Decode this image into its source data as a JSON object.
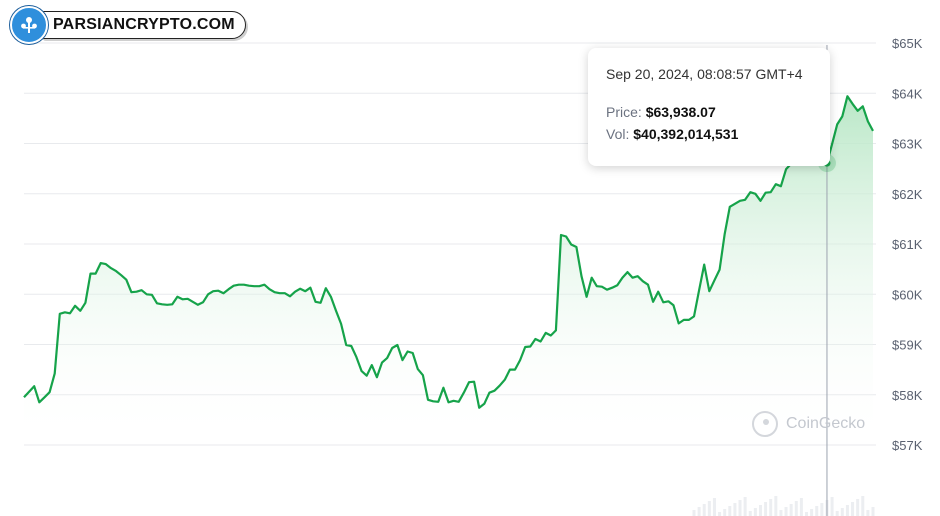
{
  "brand": {
    "logo_text": "PARSIANCRYPTO.COM"
  },
  "tooltip": {
    "date": "Sep 20, 2024, 08:08:57 GMT+4",
    "price_label": "Price:",
    "price_value": "$63,938.07",
    "vol_label": "Vol:",
    "vol_value": "$40,392,014,531"
  },
  "watermark": {
    "text": "CoinGecko"
  },
  "colors": {
    "line": "#16a34a",
    "fill_top": "#bfe9cc",
    "grid": "#e8eaed",
    "tick_text": "#5a6170"
  },
  "chart_data": {
    "type": "area",
    "title": "",
    "xlabel": "",
    "ylabel": "",
    "ylim": [
      56600,
      65200
    ],
    "y_ticks": [
      57000,
      58000,
      59000,
      60000,
      61000,
      62000,
      63000,
      64000,
      65000
    ],
    "y_tick_labels": [
      "$57K",
      "$58K",
      "$59K",
      "$60K",
      "$61K",
      "$62K",
      "$63K",
      "$64K",
      "$65K"
    ],
    "grid": true,
    "highlight_index": 157,
    "series": [
      {
        "values": [
          57950,
          58060,
          58170,
          57850,
          57950,
          58050,
          58420,
          59610,
          59640,
          59620,
          59770,
          59670,
          59830,
          60410,
          60410,
          60620,
          60600,
          60520,
          60460,
          60380,
          60290,
          60040,
          60050,
          60080,
          60000,
          59990,
          59820,
          59800,
          59790,
          59800,
          59950,
          59900,
          59910,
          59850,
          59790,
          59840,
          60000,
          60060,
          60070,
          60020,
          60100,
          60170,
          60190,
          60190,
          60170,
          60160,
          60160,
          60190,
          60100,
          60040,
          60020,
          60020,
          59960,
          60050,
          60110,
          60060,
          60130,
          59850,
          59830,
          60120,
          59950,
          59670,
          59410,
          58990,
          58970,
          58750,
          58470,
          58380,
          58590,
          58350,
          58640,
          58730,
          58930,
          58990,
          58690,
          58860,
          58830,
          58510,
          58390,
          57900,
          57870,
          57860,
          58140,
          57850,
          57880,
          57860,
          58040,
          58250,
          58260,
          57740,
          57820,
          58040,
          58080,
          58180,
          58300,
          58500,
          58500,
          58690,
          58950,
          58960,
          59110,
          59060,
          59230,
          59180,
          59280,
          61180,
          61150,
          60990,
          60940,
          60360,
          59950,
          60330,
          60160,
          60150,
          60090,
          60130,
          60180,
          60330,
          60440,
          60330,
          60360,
          60260,
          60190,
          59850,
          60050,
          59840,
          59860,
          59780,
          59420,
          59490,
          59490,
          59560,
          60080,
          60590,
          60060,
          60280,
          60490,
          61200,
          61740,
          61800,
          61860,
          61880,
          62030,
          62000,
          61860,
          62020,
          62030,
          62190,
          62150,
          62490,
          62600,
          62580,
          62700,
          62720,
          62690,
          62690,
          62730,
          62610,
          62990,
          63380,
          63540,
          63940,
          63790,
          63650,
          63740,
          63440,
          63250
        ]
      }
    ]
  }
}
